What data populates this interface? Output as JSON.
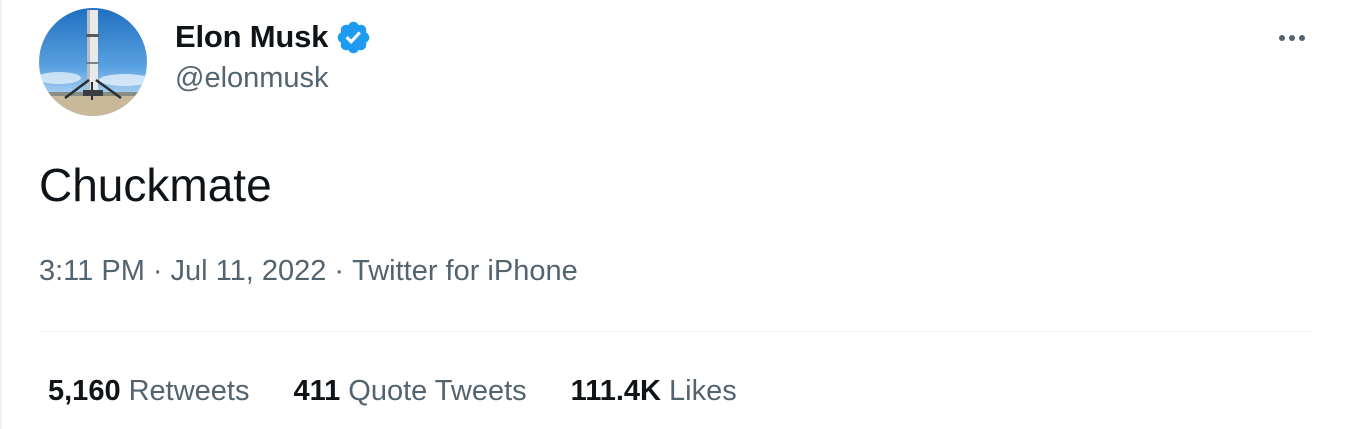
{
  "tweet": {
    "author": {
      "display_name": "Elon Musk",
      "handle": "@elonmusk",
      "verified": true,
      "avatar_icon": "rocket-booster-avatar"
    },
    "text": "Chuckmate",
    "meta": {
      "time": "3:11 PM",
      "separator": "·",
      "date": "Jul 11, 2022",
      "source": "Twitter for iPhone"
    },
    "stats": [
      {
        "count": "5,160",
        "label": "Retweets"
      },
      {
        "count": "411",
        "label": "Quote Tweets"
      },
      {
        "count": "111.4K",
        "label": "Likes"
      }
    ]
  },
  "colors": {
    "primary_text": "#0f1419",
    "secondary_text": "#536471",
    "verified_blue": "#1d9bf0",
    "divider": "#eff3f4"
  },
  "icons": {
    "verified": "verified-badge-icon",
    "more": "more-horizontal-icon"
  }
}
